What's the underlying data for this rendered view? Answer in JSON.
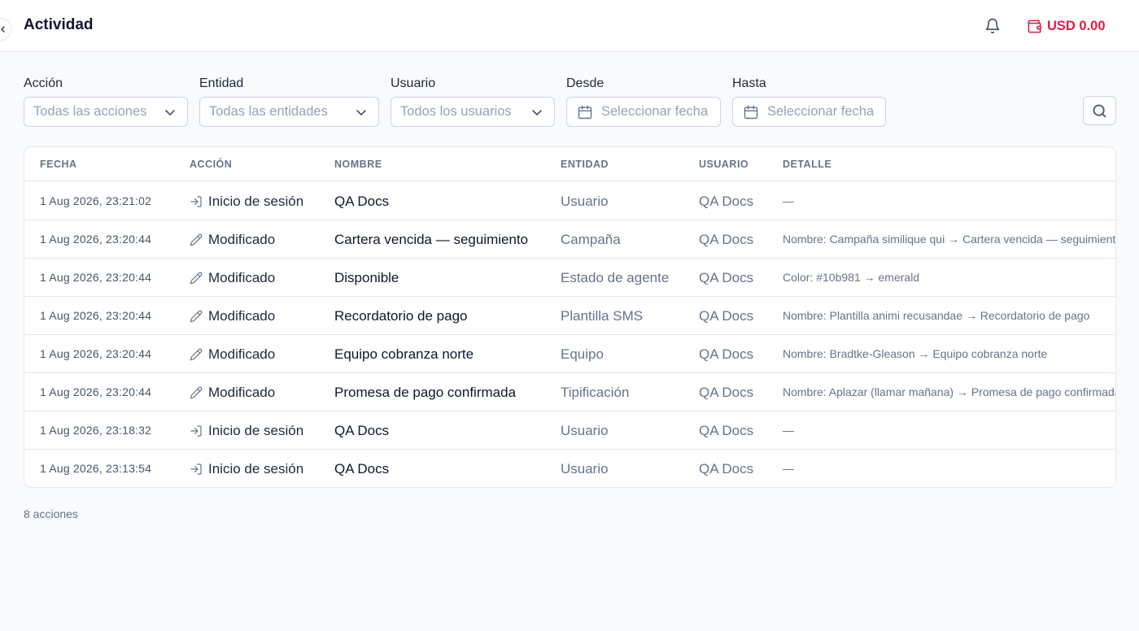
{
  "header": {
    "title": "Actividad",
    "balance": "USD 0.00",
    "accent_color": "#e11d48"
  },
  "filters": [
    {
      "label": "Acción",
      "placeholder": "Todas las acciones",
      "type": "select"
    },
    {
      "label": "Entidad",
      "placeholder": "Todas las entidades",
      "type": "select"
    },
    {
      "label": "Usuario",
      "placeholder": "Todos los usuarios",
      "type": "select"
    },
    {
      "label": "Desde",
      "placeholder": "Seleccionar fecha",
      "type": "date"
    },
    {
      "label": "Hasta",
      "placeholder": "Seleccionar fecha",
      "type": "date"
    }
  ],
  "table": {
    "columns": [
      "FECHA",
      "ACCIÓN",
      "NOMBRE",
      "ENTIDAD",
      "USUARIO",
      "DETALLE"
    ],
    "rows": [
      {
        "date": "1 Aug 2026, 23:21:02",
        "action": "Inicio de sesión",
        "action_icon": "login-icon",
        "name": "QA Docs",
        "entity": "Usuario",
        "user": "QA Docs",
        "detail": "—"
      },
      {
        "date": "1 Aug 2026, 23:20:44",
        "action": "Modificado",
        "action_icon": "pencil-icon",
        "name": "Cartera vencida — seguimiento",
        "entity": "Campaña",
        "user": "QA Docs",
        "detail": "Nombre: Campaña similique qui → Cartera vencida — seguimiento"
      },
      {
        "date": "1 Aug 2026, 23:20:44",
        "action": "Modificado",
        "action_icon": "pencil-icon",
        "name": "Disponible",
        "entity": "Estado de agente",
        "user": "QA Docs",
        "detail": "Color: #10b981 → emerald"
      },
      {
        "date": "1 Aug 2026, 23:20:44",
        "action": "Modificado",
        "action_icon": "pencil-icon",
        "name": "Recordatorio de pago",
        "entity": "Plantilla SMS",
        "user": "QA Docs",
        "detail": "Nombre: Plantilla animi recusandae → Recordatorio de pago"
      },
      {
        "date": "1 Aug 2026, 23:20:44",
        "action": "Modificado",
        "action_icon": "pencil-icon",
        "name": "Equipo cobranza norte",
        "entity": "Equipo",
        "user": "QA Docs",
        "detail": "Nombre: Bradtke-Gleason → Equipo cobranza norte"
      },
      {
        "date": "1 Aug 2026, 23:20:44",
        "action": "Modificado",
        "action_icon": "pencil-icon",
        "name": "Promesa de pago confirmada",
        "entity": "Tipificación",
        "user": "QA Docs",
        "detail": "Nombre: Aplazar (llamar mañana) → Promesa de pago confirmada"
      },
      {
        "date": "1 Aug 2026, 23:18:32",
        "action": "Inicio de sesión",
        "action_icon": "login-icon",
        "name": "QA Docs",
        "entity": "Usuario",
        "user": "QA Docs",
        "detail": "—"
      },
      {
        "date": "1 Aug 2026, 23:13:54",
        "action": "Inicio de sesión",
        "action_icon": "login-icon",
        "name": "QA Docs",
        "entity": "Usuario",
        "user": "QA Docs",
        "detail": "—"
      }
    ]
  },
  "footer": {
    "count": "8 acciones"
  }
}
